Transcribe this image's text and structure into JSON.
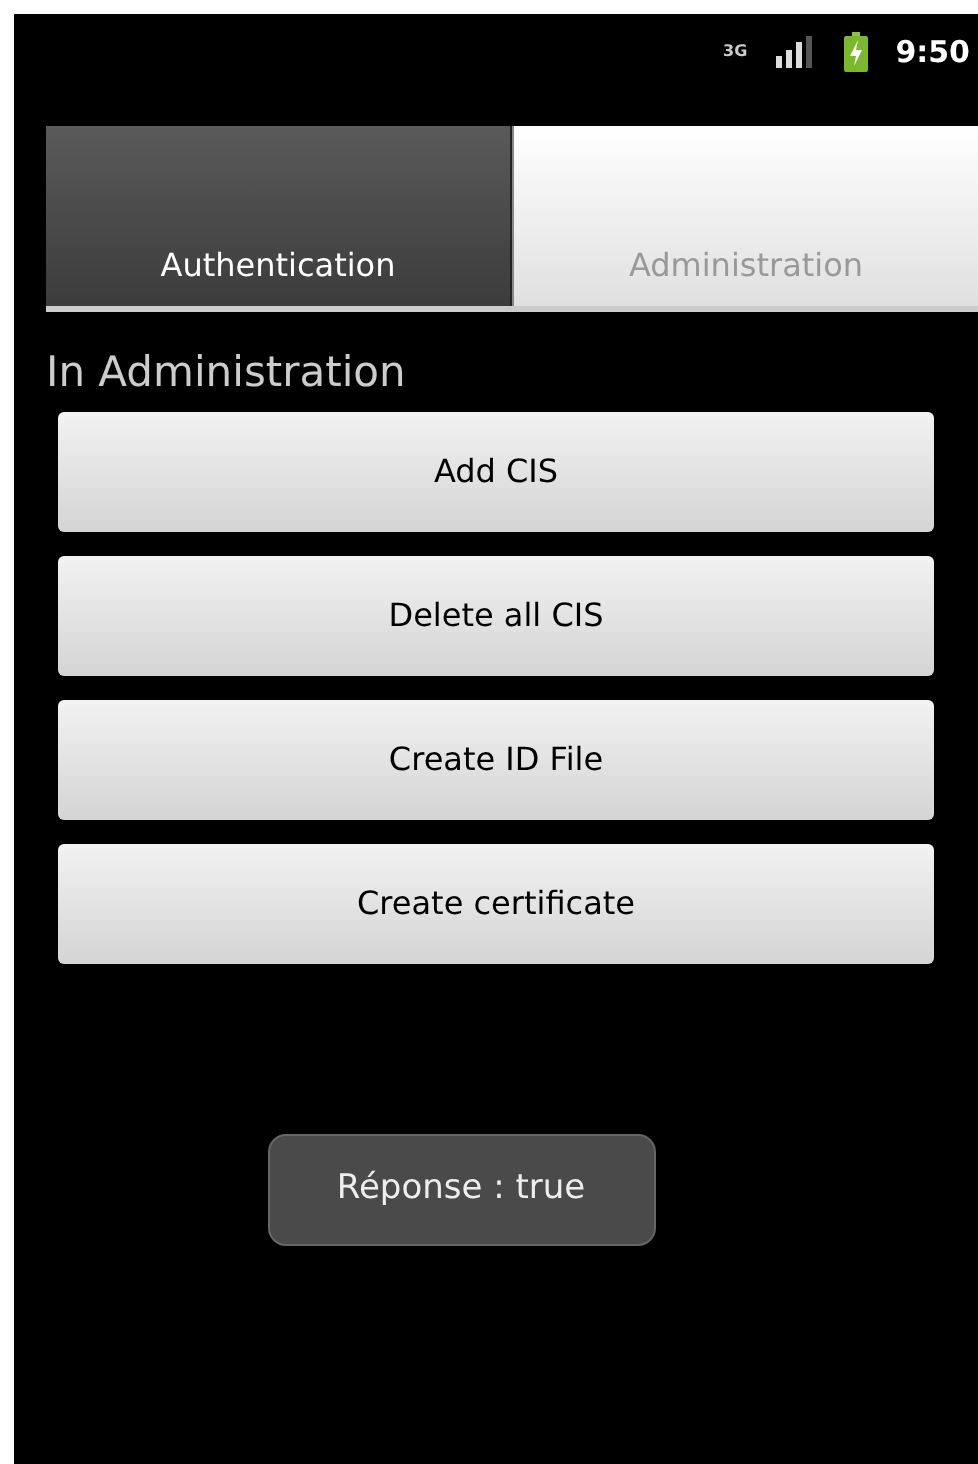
{
  "status_bar": {
    "network": "3G",
    "time": "9:50"
  },
  "tabs": [
    {
      "label": "Authentication",
      "selected": false
    },
    {
      "label": "Administration",
      "selected": true
    }
  ],
  "heading": "In Administration",
  "buttons": [
    "Add CIS",
    "Delete all CIS",
    "Create ID File",
    "Create certificate"
  ],
  "toast": "Réponse : true"
}
